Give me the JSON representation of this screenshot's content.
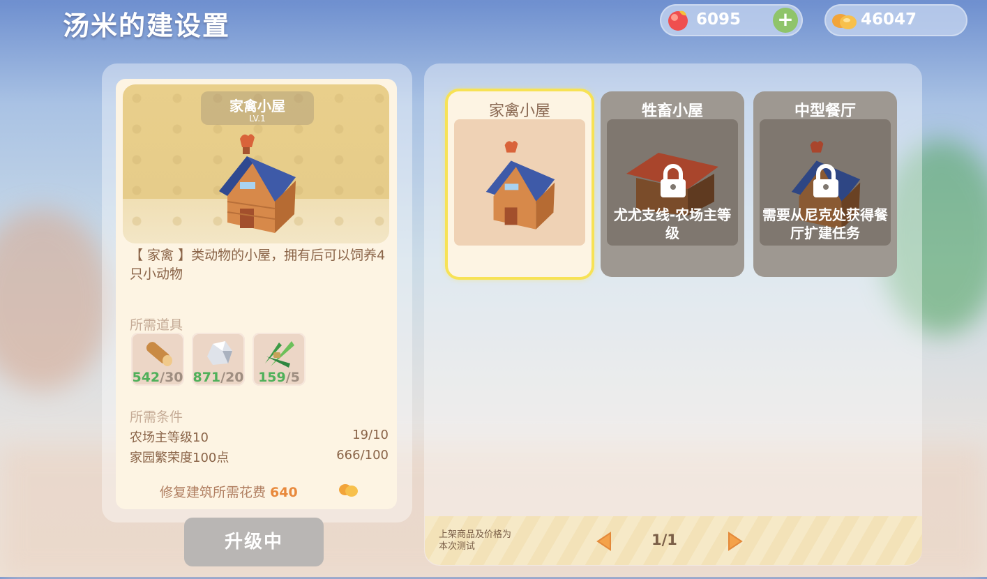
{
  "header": {
    "title": "汤米的建设置",
    "currency": [
      {
        "icon": "peach-gem-icon",
        "value": "6095",
        "has_add": true,
        "add_label": "+"
      },
      {
        "icon": "gold-coin-icon",
        "value": "46047"
      }
    ]
  },
  "detail": {
    "name": "家禽小屋",
    "level": "LV.1",
    "description": "【 家禽 】类动物的小屋，拥有后可以饲养4只小动物",
    "materials_title": "所需道具",
    "materials": [
      {
        "icon": "wood-log-icon",
        "have": "542",
        "need": "/30"
      },
      {
        "icon": "stone-icon",
        "have": "871",
        "need": "/20"
      },
      {
        "icon": "grass-bundle-icon",
        "have": "159",
        "need": "/5"
      }
    ],
    "conditions_title": "所需条件",
    "conditions": [
      {
        "label": "农场主等级10",
        "value": "19/10"
      },
      {
        "label": "家园繁荣度100点",
        "value": "666/100"
      }
    ],
    "cost_label": "修复建筑所需花费",
    "cost_value": "640",
    "cost_icon": "gold-coin-icon",
    "upgrade_button": "升级中"
  },
  "buildings": [
    {
      "name": "家禽小屋",
      "locked": false,
      "selected": true,
      "lock_text": ""
    },
    {
      "name": "牲畜小屋",
      "locked": true,
      "selected": false,
      "lock_text": "尤尤支线-农场主等级"
    },
    {
      "name": "中型餐厅",
      "locked": true,
      "selected": false,
      "lock_text": "需要从尼克处获得餐厅扩建任务"
    }
  ],
  "footer": {
    "note": "上架商品及价格为本次测试",
    "page": "1/1"
  },
  "colors": {
    "accent_green": "#4fb05a",
    "selected_border": "#f7e255",
    "locked_card": "#9e9891"
  }
}
